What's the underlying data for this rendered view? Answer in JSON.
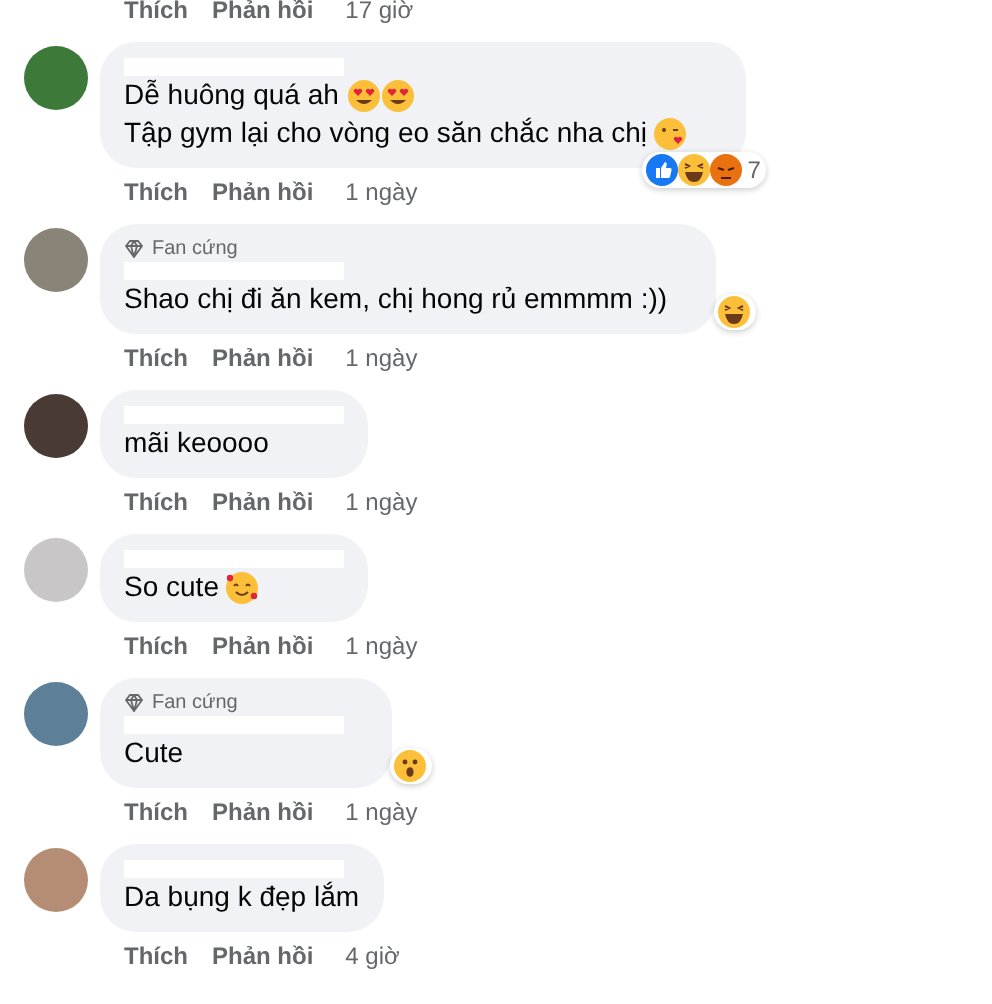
{
  "top_actions": {
    "like": "Thích",
    "reply": "Phản hồi",
    "time": "17 giờ"
  },
  "comments": [
    {
      "lines": [
        [
          {
            "kind": "text",
            "text": "Dễ huông quá ah "
          },
          {
            "kind": "heart-eyes"
          },
          {
            "kind": "heart-eyes"
          }
        ],
        [
          {
            "kind": "text",
            "text": "Tập gym lại cho vòng eo săn chắc nha chị "
          },
          {
            "kind": "kiss"
          }
        ]
      ],
      "reactions": [
        {
          "kind": "like"
        },
        {
          "kind": "haha"
        },
        {
          "kind": "angry"
        }
      ],
      "reaction_count": "7",
      "like": "Thích",
      "reply": "Phản hồi",
      "time": "1 ngày"
    },
    {
      "badge": "Fan cứng",
      "lines": [
        [
          {
            "kind": "text",
            "text": "Shao chị đi ăn kem, chị hong rủ emmmm :))"
          }
        ]
      ],
      "reactions": [
        {
          "kind": "haha"
        }
      ],
      "like": "Thích",
      "reply": "Phản hồi",
      "time": "1 ngày"
    },
    {
      "lines": [
        [
          {
            "kind": "text",
            "text": "mãi keoooo"
          }
        ]
      ],
      "like": "Thích",
      "reply": "Phản hồi",
      "time": "1 ngày"
    },
    {
      "lines": [
        [
          {
            "kind": "text",
            "text": "So cute "
          },
          {
            "kind": "hearts-face"
          }
        ]
      ],
      "like": "Thích",
      "reply": "Phản hồi",
      "time": "1 ngày"
    },
    {
      "badge": "Fan cứng",
      "lines": [
        [
          {
            "kind": "text",
            "text": "Cute"
          }
        ]
      ],
      "reactions": [
        {
          "kind": "wow"
        }
      ],
      "like": "Thích",
      "reply": "Phản hồi",
      "time": "1 ngày"
    },
    {
      "lines": [
        [
          {
            "kind": "text",
            "text": "Da bụng k đẹp lắm"
          }
        ]
      ],
      "like": "Thích",
      "reply": "Phản hồi",
      "time": "4 giờ"
    }
  ]
}
